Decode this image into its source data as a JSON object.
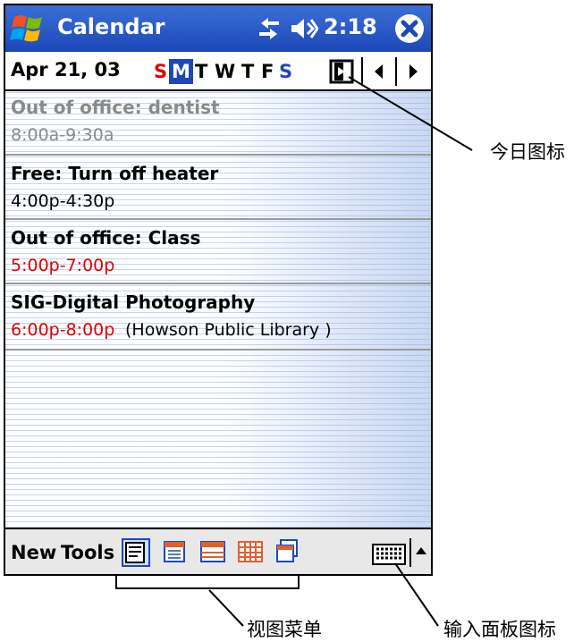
{
  "titlebar": {
    "app_title": "Calendar",
    "clock": "2:18"
  },
  "datebar": {
    "date": "Apr 21, 03",
    "days": [
      "S",
      "M",
      "T",
      "W",
      "T",
      "F",
      "S"
    ],
    "selected_day_index": 1,
    "weekend_color": "#e00000",
    "saturday_color": "#1c48b8"
  },
  "appointments": [
    {
      "title": "Out of office: dentist",
      "time": "8:00a-9:30a",
      "location": "",
      "title_color": "#8a8a8a",
      "time_color": "#8a8a8a"
    },
    {
      "title": "Free: Turn off heater",
      "time": "4:00p-4:30p",
      "location": "",
      "title_color": "#000000",
      "time_color": "#000000"
    },
    {
      "title": "Out of office: Class",
      "time": "5:00p-7:00p",
      "location": "",
      "title_color": "#000000",
      "time_color": "#e00000"
    },
    {
      "title": "SIG-Digital Photography",
      "time": "6:00p-8:00p",
      "location": "(Howson Public Library )",
      "title_color": "#000000",
      "time_color": "#e00000"
    }
  ],
  "bottombar": {
    "new_label": "New",
    "tools_label": "Tools",
    "views": [
      "agenda-view-icon",
      "day-view-icon",
      "week-view-icon",
      "month-view-icon",
      "year-view-icon"
    ]
  },
  "callouts": {
    "today_icon": "今日图标",
    "view_menu": "视图菜单",
    "input_panel_icon": "输入面板图标"
  },
  "colors": {
    "title_bar": "#1c48b8",
    "selected_day_bg": "#1c48b8"
  }
}
